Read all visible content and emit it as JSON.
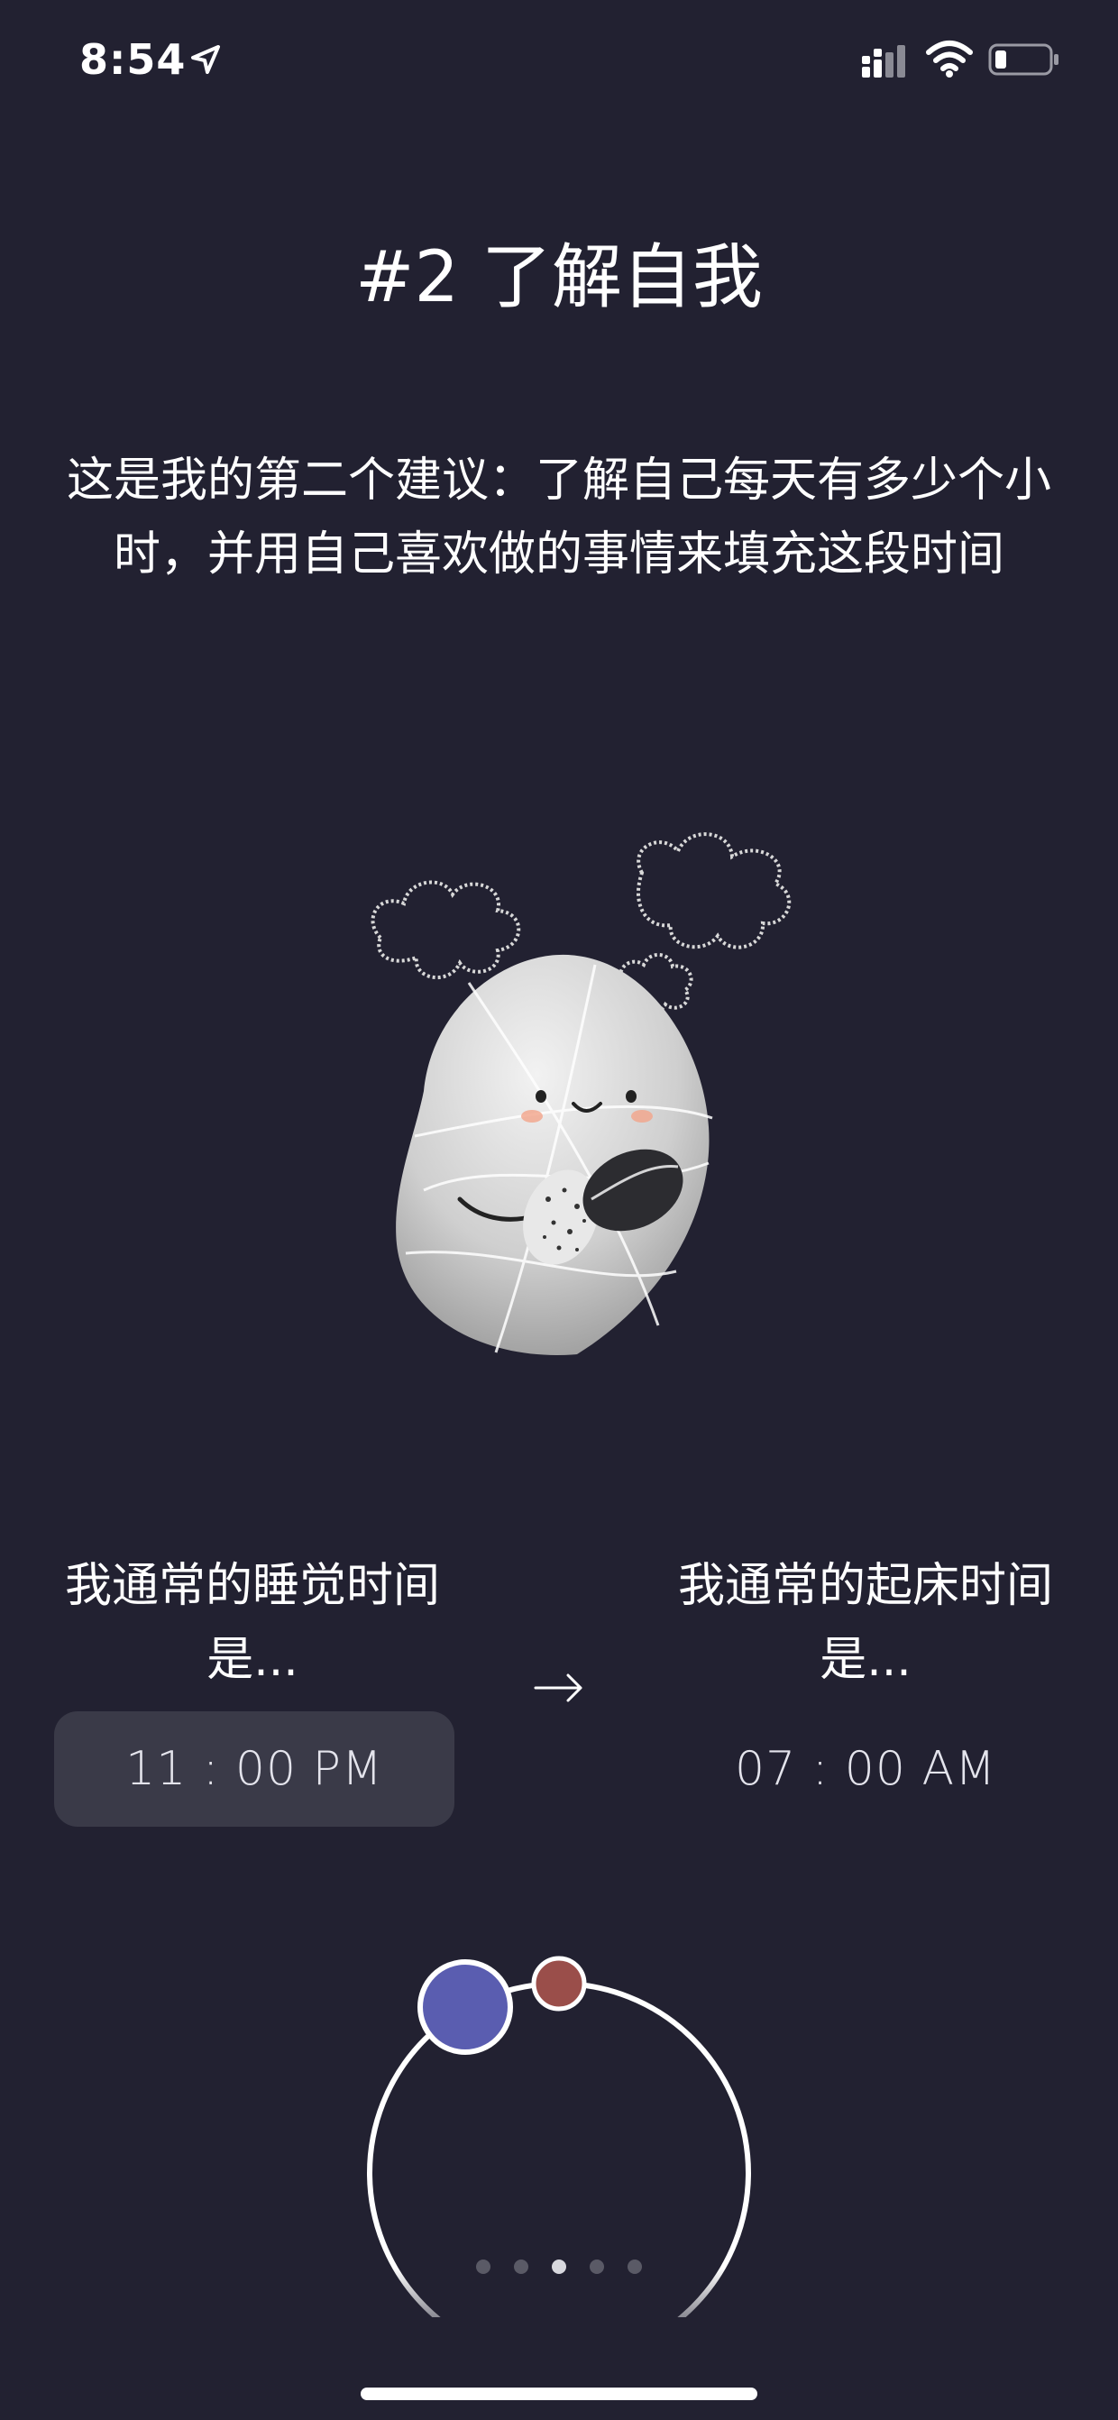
{
  "status_bar": {
    "time": "8:54",
    "icons": [
      "location-arrow-icon",
      "cellular-signal-icon",
      "wifi-icon",
      "battery-low-icon"
    ]
  },
  "header": {
    "title": "#2 了解自我"
  },
  "intro": {
    "text": "这是我的第二个建议：了解自己每天有多少个小时，并用自己喜欢做的事情来填充这段时间"
  },
  "illustration": {
    "icon": "stone-character-with-clouds-illustration"
  },
  "schedule": {
    "bedtime_label": "我通常的睡觉时间是...",
    "bedtime_value": "11 : 00 PM",
    "arrow_icon": "arrow-right-icon",
    "wake_label": "我通常的起床时间是...",
    "wake_value": "07 : 00 AM"
  },
  "dial": {
    "bedtime_color": "#5a5db0",
    "wake_color": "#9a4e4a"
  },
  "pagination": {
    "total": 5,
    "current": 3
  },
  "colors": {
    "background": "#222131",
    "accent_blue": "#5a5db0",
    "accent_red": "#9a4e4a",
    "picker_bg": "#3a3a48"
  }
}
